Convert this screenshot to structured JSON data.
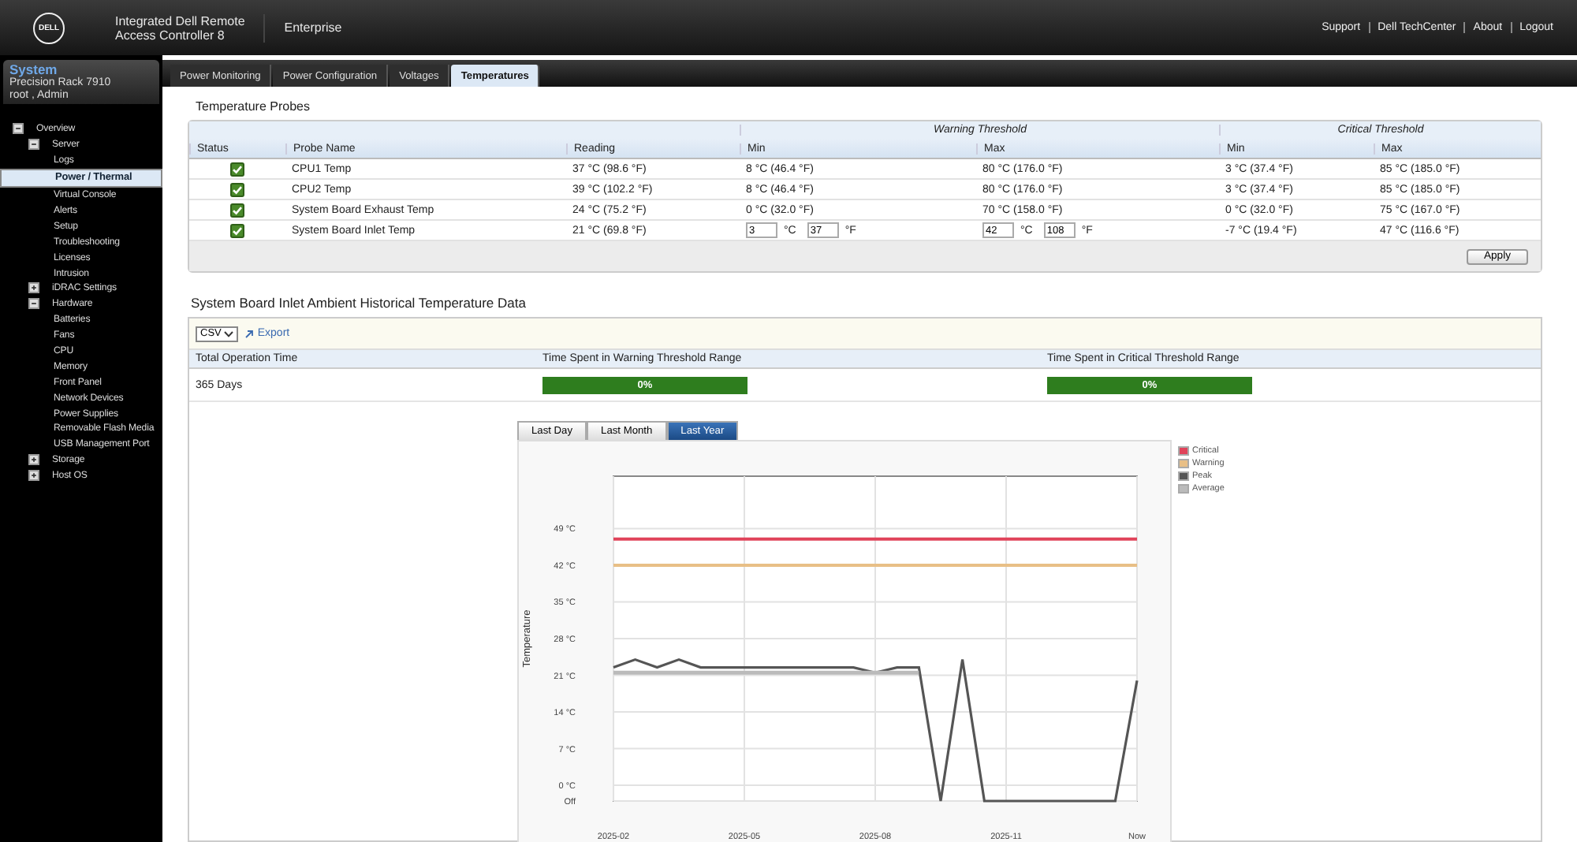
{
  "header": {
    "logo_text": "DELL",
    "title_lines": [
      "Integrated Dell Remote",
      "Access Controller 8"
    ],
    "edition": "Enterprise",
    "links": [
      "Support",
      "Dell TechCenter",
      "About",
      "Logout"
    ]
  },
  "sidebar": {
    "system_title": "System",
    "model": "Precision Rack 7910",
    "user": "root , Admin",
    "tree": [
      {
        "label": "Overview",
        "expanded": true,
        "selected": false,
        "children": [
          {
            "label": "Server",
            "expanded": true,
            "selected": false,
            "children": [
              {
                "label": "Logs",
                "selected": false
              },
              {
                "label": "Power / Thermal",
                "selected": true
              },
              {
                "label": "Virtual Console",
                "selected": false
              },
              {
                "label": "Alerts",
                "selected": false
              },
              {
                "label": "Setup",
                "selected": false
              },
              {
                "label": "Troubleshooting",
                "selected": false
              },
              {
                "label": "Licenses",
                "selected": false
              },
              {
                "label": "Intrusion",
                "selected": false
              }
            ]
          },
          {
            "label": "iDRAC Settings",
            "expanded": false,
            "selected": false
          },
          {
            "label": "Hardware",
            "expanded": true,
            "selected": false,
            "children": [
              {
                "label": "Batteries",
                "selected": false
              },
              {
                "label": "Fans",
                "selected": false
              },
              {
                "label": "CPU",
                "selected": false
              },
              {
                "label": "Memory",
                "selected": false
              },
              {
                "label": "Front Panel",
                "selected": false
              },
              {
                "label": "Network Devices",
                "selected": false
              },
              {
                "label": "Power Supplies",
                "selected": false
              },
              {
                "label": "Removable Flash Media",
                "selected": false
              },
              {
                "label": "USB Management Port",
                "selected": false
              }
            ]
          },
          {
            "label": "Storage",
            "expanded": false,
            "selected": false
          },
          {
            "label": "Host OS",
            "expanded": false,
            "selected": false
          }
        ]
      }
    ]
  },
  "tabs": [
    {
      "label": "Power Monitoring",
      "selected": false
    },
    {
      "label": "Power Configuration",
      "selected": false
    },
    {
      "label": "Voltages",
      "selected": false
    },
    {
      "label": "Temperatures",
      "selected": true
    }
  ],
  "probes": {
    "title": "Temperature Probes",
    "group_headers": [
      "Warning Threshold",
      "Critical Threshold"
    ],
    "columns": [
      "Status",
      "Probe Name",
      "Reading",
      "Min",
      "Max",
      "Min",
      "Max"
    ],
    "rows": [
      {
        "status_ok": true,
        "name": "CPU1 Temp",
        "reading": "37 °C (98.6 °F)",
        "warning_min": {
          "kind": "text",
          "text": "8 °C (46.4 °F)"
        },
        "warning_max": {
          "kind": "text",
          "text": "80 °C (176.0 °F)"
        },
        "critical_min": "3 °C (37.4 °F)",
        "critical_max": "85 °C (185.0 °F)"
      },
      {
        "status_ok": true,
        "name": "CPU2 Temp",
        "reading": "39 °C (102.2 °F)",
        "warning_min": {
          "kind": "text",
          "text": "8 °C (46.4 °F)"
        },
        "warning_max": {
          "kind": "text",
          "text": "80 °C (176.0 °F)"
        },
        "critical_min": "3 °C (37.4 °F)",
        "critical_max": "85 °C (185.0 °F)"
      },
      {
        "status_ok": true,
        "name": "System Board Exhaust Temp",
        "reading": "24 °C (75.2 °F)",
        "warning_min": {
          "kind": "text",
          "text": "0 °C (32.0 °F)"
        },
        "warning_max": {
          "kind": "text",
          "text": "70 °C (158.0 °F)"
        },
        "critical_min": "0 °C (32.0 °F)",
        "critical_max": "75 °C (167.0 °F)"
      },
      {
        "status_ok": true,
        "name": "System Board Inlet Temp",
        "reading": "21 °C (69.8 °F)",
        "warning_min": {
          "kind": "input",
          "celsius": "3",
          "celsius_unit": "°C",
          "fahrenheit": "37",
          "fahrenheit_unit": "°F"
        },
        "warning_max": {
          "kind": "input",
          "celsius": "42",
          "celsius_unit": "°C",
          "fahrenheit": "108",
          "fahrenheit_unit": "°F"
        },
        "critical_min": "-7 °C (19.4 °F)",
        "critical_max": "47 °C (116.6 °F)"
      }
    ],
    "apply_button": "Apply"
  },
  "history": {
    "title": "System Board Inlet Ambient Historical Temperature Data",
    "format_select": "CSV",
    "export_link": "Export",
    "summary_columns": [
      "Total Operation Time",
      "Time Spent in Warning Threshold Range",
      "Time Spent in Critical Threshold Range"
    ],
    "total_time": "365 Days",
    "warning_time": "0%",
    "critical_time": "0%",
    "range_tabs": [
      {
        "label": "Last Day",
        "selected": false
      },
      {
        "label": "Last Month",
        "selected": false
      },
      {
        "label": "Last Year",
        "selected": true
      }
    ],
    "chart_data": {
      "type": "line",
      "ylabel": "Temperature",
      "grid": true,
      "categories": [
        "2025-02",
        null,
        null,
        null,
        null,
        null,
        "2025-05",
        null,
        null,
        null,
        null,
        null,
        "2025-08",
        null,
        null,
        null,
        null,
        null,
        "2025-11",
        null,
        null,
        null,
        null,
        null,
        "Now"
      ],
      "series": [
        {
          "name": "Critical",
          "color": "#e0435a",
          "values": [
            47,
            47,
            47,
            47,
            47,
            47,
            47,
            47,
            47,
            47,
            47,
            47,
            47,
            47,
            47,
            47,
            47,
            47,
            47,
            47,
            47,
            47,
            47,
            47,
            47
          ]
        },
        {
          "name": "Warning",
          "color": "#e8bf86",
          "values": [
            42,
            42,
            42,
            42,
            42,
            42,
            42,
            42,
            42,
            42,
            42,
            42,
            42,
            42,
            42,
            42,
            42,
            42,
            42,
            42,
            42,
            42,
            42,
            42,
            42
          ]
        },
        {
          "name": "Peak",
          "color": "#555555",
          "values": [
            22.5,
            24,
            22.5,
            24,
            22.5,
            22.5,
            22.5,
            22.5,
            22.5,
            22.5,
            22.5,
            22.5,
            21.5,
            22.5,
            22.5,
            -3,
            24,
            -3,
            -3,
            -3,
            -3,
            -3,
            -3,
            -3,
            20
          ]
        },
        {
          "name": "Average",
          "color": "#bbbbbb",
          "values": [
            21.5,
            21.5,
            21.5,
            21.5,
            21.5,
            21.5,
            21.5,
            21.5,
            21.5,
            21.5,
            21.5,
            21.5,
            21.5,
            21.5,
            21.5,
            null,
            null,
            null,
            null,
            null,
            null,
            null,
            null,
            null,
            null
          ]
        }
      ],
      "ylim": [
        -3,
        59
      ],
      "yticks": [
        {
          "value": -3,
          "label": "Off"
        },
        {
          "value": 0,
          "label": "0 °C"
        },
        {
          "value": 7,
          "label": "7 °C"
        },
        {
          "value": 14,
          "label": "14 °C"
        },
        {
          "value": 21,
          "label": "21 °C"
        },
        {
          "value": 28,
          "label": "28 °C"
        },
        {
          "value": 35,
          "label": "35 °C"
        },
        {
          "value": 42,
          "label": "42 °C"
        },
        {
          "value": 49,
          "label": "49 °C"
        }
      ]
    }
  }
}
